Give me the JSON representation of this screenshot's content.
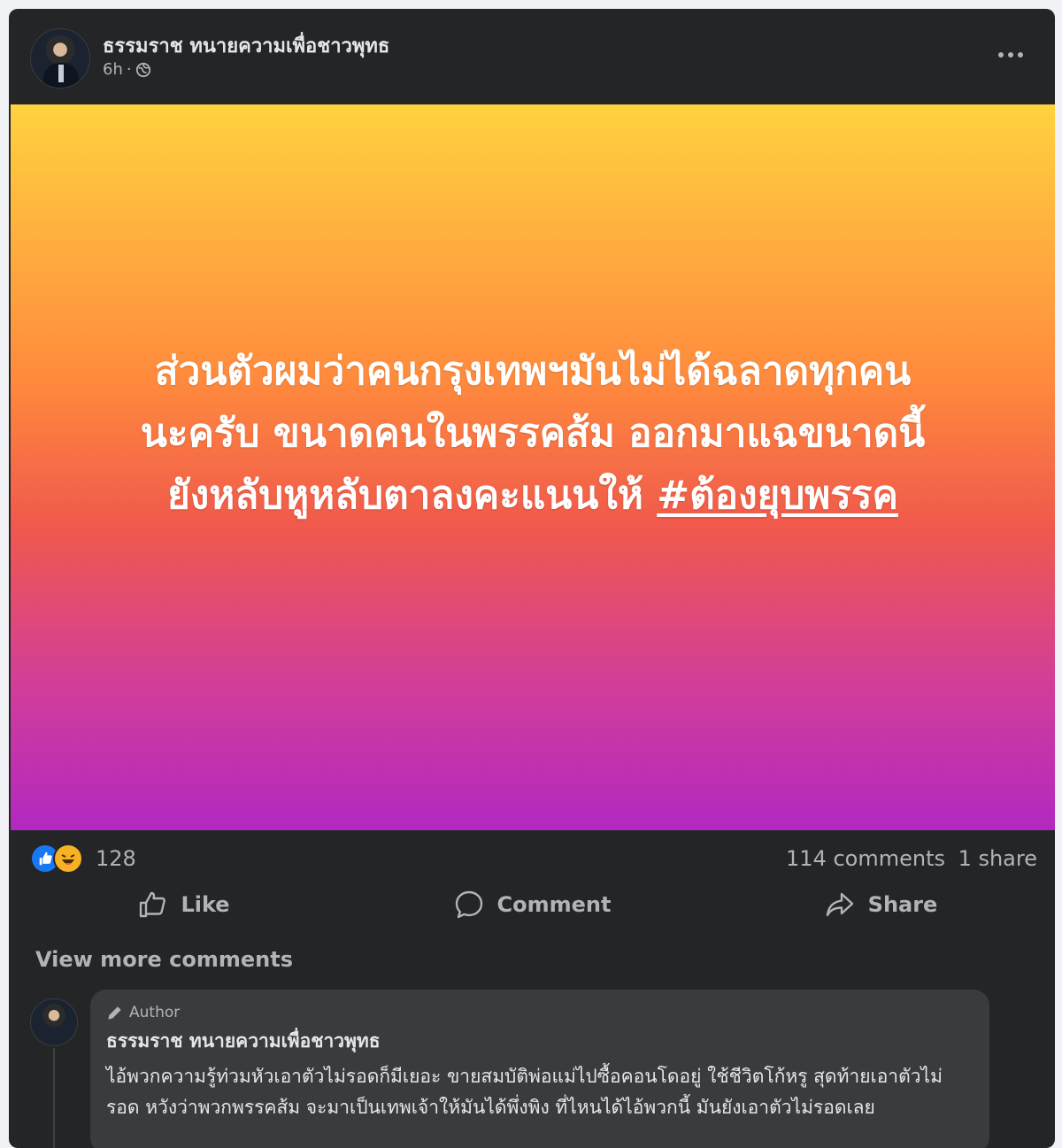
{
  "post": {
    "author": "ธรรมราช ทนายความเพื่อชาวพุทธ",
    "time": "6h",
    "separator": "·",
    "text_lines": [
      "ส่วนตัวผมว่าคนกรุงเทพฯมันไม่ได้ฉลาดทุกคน",
      "นะครับ ขนาดคนในพรรคส้ม ออกมาแฉขนาดนี้",
      "ยังหลับหูหลับตาลงคะแนนให้ "
    ],
    "hashtag": "#ต้องยุบพรรค",
    "background_gradient": [
      "#ffd23f",
      "#ff8a3d",
      "#f0594c",
      "#d23d9a",
      "#b228c0"
    ]
  },
  "reactions": {
    "count": "128",
    "icons": [
      "like-icon",
      "haha-icon"
    ],
    "comments": "114 comments",
    "shares": "1 share"
  },
  "actions": {
    "like": "Like",
    "comment": "Comment",
    "share": "Share"
  },
  "comments": {
    "view_more": "View more comments",
    "items": [
      {
        "badge": "Author",
        "author": "ธรรมราช ทนายความเพื่อชาวพุทธ",
        "text": "ไอ้พวกความรู้ท่วมหัวเอาตัวไม่รอดก็มีเยอะ ขายสมบัติพ่อแม่ไปซื้อคอนโดอยู่ ใช้ชีวิตโก้หรู สุดท้ายเอาตัวไม่รอด หวังว่าพวกพรรคส้ม จะมาเป็นเทพเจ้าให้มันได้พึ่งพิง ที่ไหนได้ไอ้พวกนี้ มันยังเอาตัวไม่รอดเลย"
      }
    ]
  }
}
